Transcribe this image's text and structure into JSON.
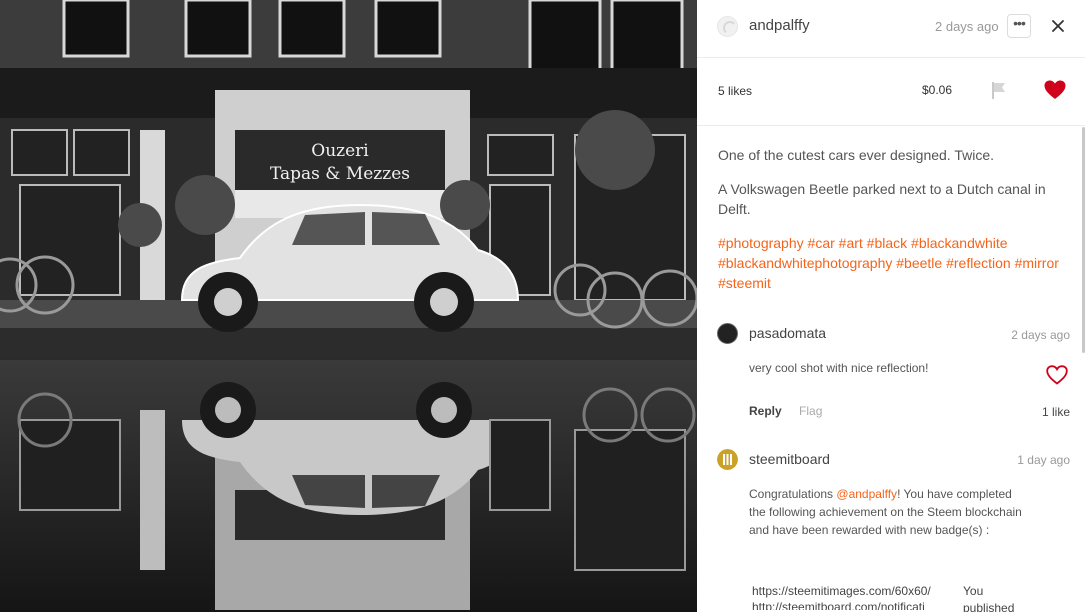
{
  "post": {
    "author": "andpalffy",
    "time": "2 days ago",
    "more_label": "•••",
    "likes": "5 likes",
    "payout": "$0.06",
    "paragraph1": "One of the cutest cars ever designed. Twice.",
    "paragraph2": "A Volkswagen Beetle parked next to a Dutch canal in Delft.",
    "tags": [
      "#photography",
      "#car",
      "#art",
      "#black",
      "#blackandwhite",
      "#blackandwhitephotography",
      "#beetle",
      "#reflection",
      "#mirror",
      "#steemit"
    ]
  },
  "photo": {
    "sign_line1": "Ouzeri",
    "sign_line2": "Tapas & Mezzes"
  },
  "comments": [
    {
      "author": "pasadomata",
      "time": "2 days ago",
      "text": "very cool shot with nice reflection!",
      "reply_label": "Reply",
      "flag_label": "Flag",
      "likes": "1 like"
    },
    {
      "author": "steemitboard",
      "time": "1 day ago",
      "text_before": "Congratulations ",
      "mention": "@andpalffy",
      "text_after": "! You have completed the following achievement on the Steem blockchain and have been rewarded with new badge(s) :",
      "url1": "https://steemitimages.com/60x60/",
      "url2": "http://steemitboard.com/notificati",
      "aside_line1": "You",
      "aside_line2": "published"
    }
  ],
  "colors": {
    "accent": "#f4641b",
    "heart": "#d0021b"
  }
}
